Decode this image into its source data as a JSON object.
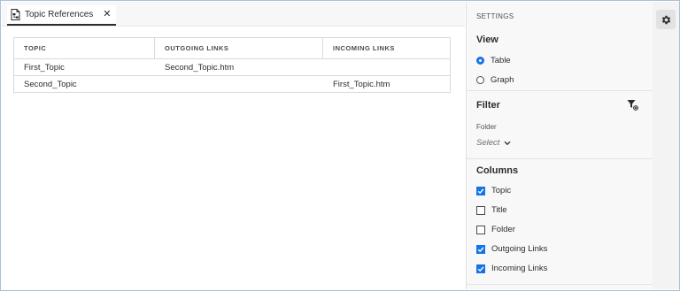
{
  "tab": {
    "label": "Topic References",
    "close": "✕",
    "icon": "topic-references-icon"
  },
  "table": {
    "headers": [
      "TOPIC",
      "OUTGOING LINKS",
      "INCOMING LINKS"
    ],
    "rows": [
      [
        "First_Topic",
        "Second_Topic.htm",
        ""
      ],
      [
        "Second_Topic",
        "",
        "First_Topic.htm"
      ]
    ]
  },
  "settings": {
    "title": "SETTINGS",
    "view": {
      "title": "View",
      "options": [
        {
          "label": "Table",
          "selected": true
        },
        {
          "label": "Graph",
          "selected": false
        }
      ]
    },
    "filter": {
      "title": "Filter",
      "folder_label": "Folder",
      "folder_select": "Select"
    },
    "columns": {
      "title": "Columns",
      "options": [
        {
          "label": "Topic",
          "checked": true
        },
        {
          "label": "Title",
          "checked": false
        },
        {
          "label": "Folder",
          "checked": false
        },
        {
          "label": "Outgoing Links",
          "checked": true
        },
        {
          "label": "Incoming Links",
          "checked": true
        }
      ]
    }
  },
  "rail": {
    "icon": "gear-icon"
  },
  "colors": {
    "accent": "#1473e6",
    "border": "#a9bfd6"
  }
}
